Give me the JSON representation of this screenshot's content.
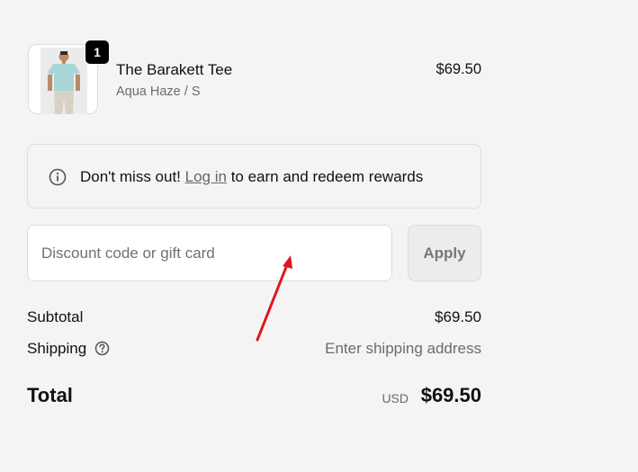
{
  "line_item": {
    "quantity": "1",
    "name": "The Barakett Tee",
    "variant": "Aqua Haze / S",
    "price": "$69.50",
    "image_icon": "product-tee-image"
  },
  "rewards": {
    "lead": "Don't miss out!",
    "link": "Log in",
    "trail": "to earn and redeem rewards",
    "icon": "info-icon"
  },
  "discount": {
    "placeholder": "Discount code or gift card",
    "apply_label": "Apply"
  },
  "summary": {
    "subtotal_label": "Subtotal",
    "subtotal_value": "$69.50",
    "shipping_label": "Shipping",
    "shipping_value": "Enter shipping address",
    "total_label": "Total",
    "total_currency": "USD",
    "total_value": "$69.50"
  },
  "colors": {
    "background": "#f4f4f4",
    "annotation_arrow": "#e0161b",
    "badge": "#000000"
  }
}
